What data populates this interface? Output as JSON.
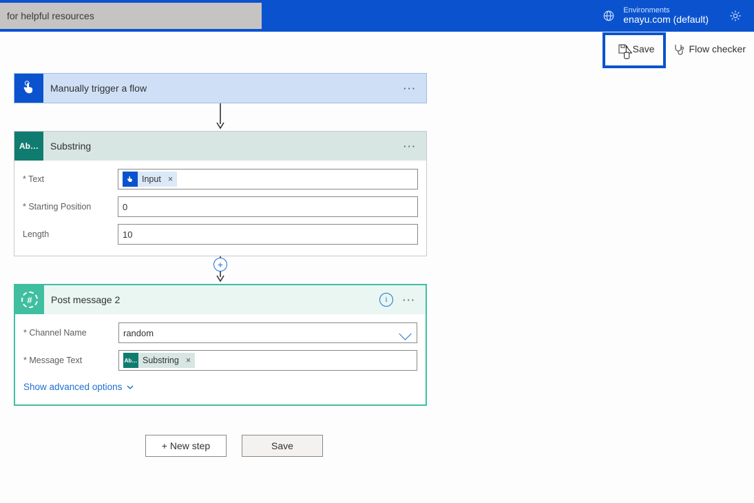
{
  "ribbon": {
    "search_text": "for helpful resources",
    "env_label": "Environments",
    "env_name": "enayu.com (default)"
  },
  "cmdbar": {
    "save": "Save",
    "checker": "Flow checker"
  },
  "trigger": {
    "title": "Manually trigger a flow"
  },
  "substring": {
    "title": "Substring",
    "icon_text": "Ab…",
    "fields": {
      "text_label": "* Text",
      "text_token": "Input",
      "start_label": "* Starting Position",
      "start_value": "0",
      "length_label": "Length",
      "length_value": "10"
    }
  },
  "slack": {
    "title": "Post message 2",
    "fields": {
      "channel_label": "* Channel Name",
      "channel_value": "random",
      "msg_label": "* Message Text",
      "msg_token": "Substring",
      "msg_token_icon": "Ab…"
    },
    "adv": "Show advanced options"
  },
  "bottom": {
    "new_step": "+ New step",
    "save": "Save"
  }
}
